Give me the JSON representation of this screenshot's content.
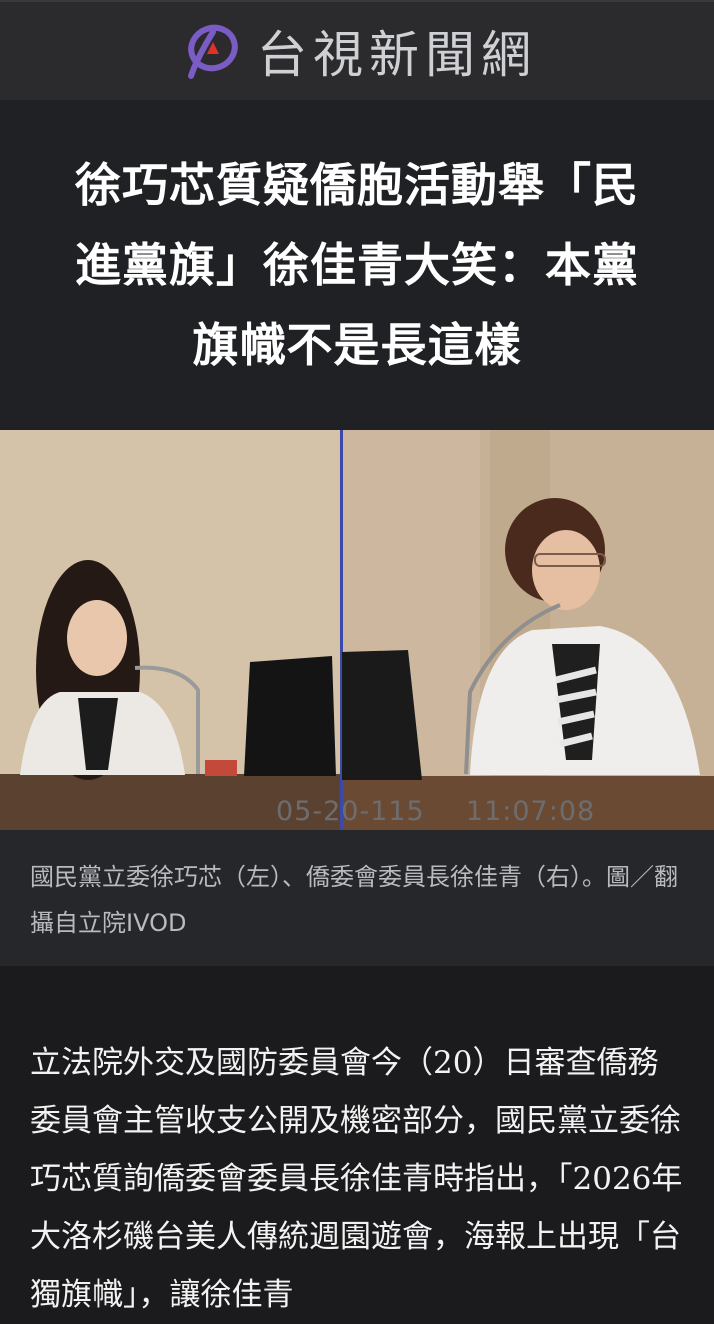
{
  "header": {
    "site_name": "台視新聞網",
    "logo_icon": "ttv-logo-icon"
  },
  "headline": {
    "title": "徐巧芯質疑僑胞活動舉「民進黨旗」徐佳青大笑：本黨旗幟不是長這樣"
  },
  "photo": {
    "timestamp_date": "05-20-115",
    "timestamp_time": "11:07:08"
  },
  "caption": {
    "text": "國民黨立委徐巧芯（左）、僑委會委員長徐佳青（右）。圖／翻攝自立院IVOD"
  },
  "article": {
    "paragraph": "立法院外交及國防委員會今（20）日審查僑務委員會主管收支公開及機密部分，國民黨立委徐巧芯質詢僑委會委員長徐佳青時指出，「2026年大洛杉磯台美人傳統週園遊會，海報上出現「台獨旗幟」，讓徐佳青"
  },
  "colors": {
    "topbar": "#2b2b2e",
    "headline_bg": "#1f2124",
    "caption_bg": "#26272a",
    "logo_purple": "#7b5cc4",
    "logo_red": "#e0302a"
  }
}
